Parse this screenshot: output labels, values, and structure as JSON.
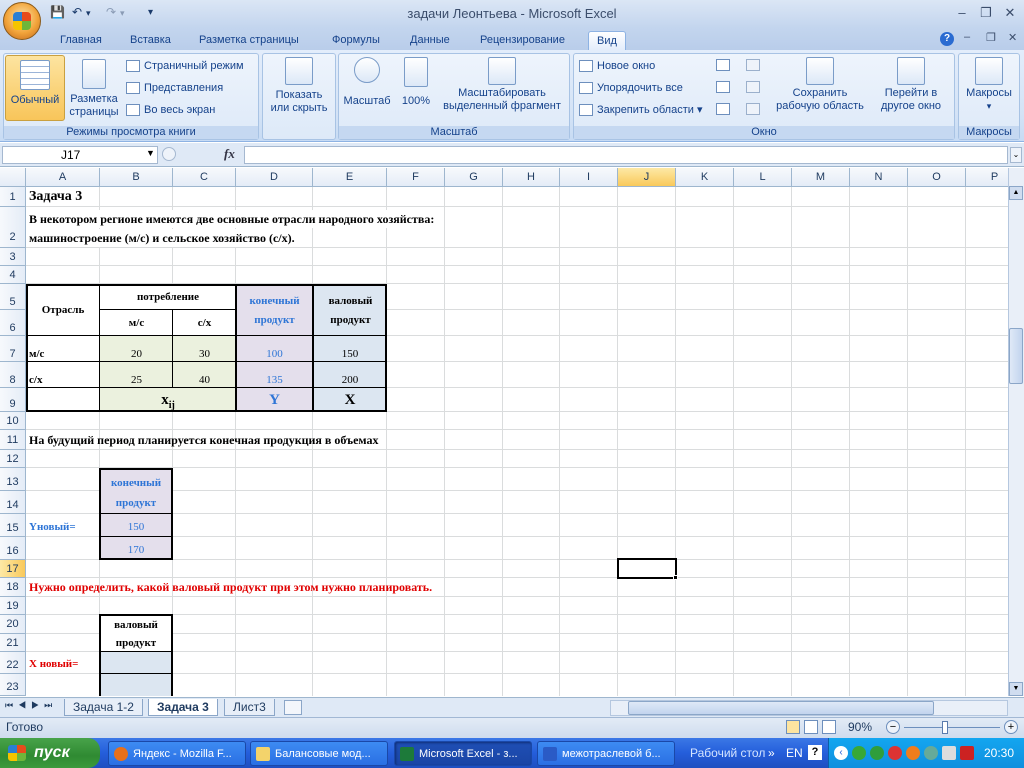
{
  "window": {
    "title": "задачи Леонтьева - Microsoft Excel",
    "min_symbol": "–",
    "max_symbol": "❐",
    "close_symbol": "✕",
    "ribbon_help_symbol": "?"
  },
  "ribbon": {
    "tabs": [
      "Главная",
      "Вставка",
      "Разметка страницы",
      "Формулы",
      "Данные",
      "Рецензирование",
      "Вид"
    ],
    "active_tab": "Вид",
    "groups": {
      "views": {
        "label": "Режимы просмотра книги",
        "normal": "Обычный",
        "page_layout_1": "Разметка",
        "page_layout_2": "страницы",
        "page_mode": "Страничный режим",
        "custom_views": "Представления",
        "full_screen": "Во весь экран"
      },
      "show_hide": {
        "label_1": "Показать",
        "label_2": "или скрыть"
      },
      "zoom": {
        "label": "Масштаб",
        "zoom": "Масштаб",
        "hundred": "100%",
        "selection_1": "Масштабировать",
        "selection_2": "выделенный фрагмент"
      },
      "window": {
        "label": "Окно",
        "new_window": "Новое окно",
        "arrange_all": "Упорядочить все",
        "freeze_panes": "Закрепить области",
        "save_ws_1": "Сохранить",
        "save_ws_2": "рабочую область",
        "switch_1": "Перейти в",
        "switch_2": "другое окно"
      },
      "macros": {
        "label": "Макросы",
        "button": "Макросы"
      }
    }
  },
  "formula_bar": {
    "name_box": "J17",
    "fx": "fx",
    "formula": ""
  },
  "grid": {
    "columns": [
      "A",
      "B",
      "C",
      "D",
      "E",
      "F",
      "G",
      "H",
      "I",
      "J",
      "K",
      "L",
      "M",
      "N",
      "O",
      "P"
    ],
    "rows": [
      "1",
      "2",
      "3",
      "4",
      "5",
      "6",
      "7",
      "8",
      "9",
      "10",
      "11",
      "12",
      "13",
      "14",
      "15",
      "16",
      "17",
      "18",
      "19",
      "20",
      "21",
      "22",
      "23"
    ],
    "selected_column": "J",
    "selected_row": "17",
    "cells": {
      "title": "Задача 3",
      "intro_1": "В некотором регионе имеются две основные отрасли народного хозяйства:",
      "intro_2": "машиностроение (м/с) и сельское хозяйство (с/х).",
      "table1": {
        "branch_header": "Отрасль",
        "consumption_header": "потребление",
        "col_ms": "м/с",
        "col_sh": "с/х",
        "final_header_1": "конечный",
        "final_header_2": "продукт",
        "gross_header_1": "валовый",
        "gross_header_2": "продукт",
        "row1_label": "м/с",
        "row1": [
          "20",
          "30",
          "100",
          "150"
        ],
        "row2_label": "с/х",
        "row2": [
          "25",
          "40",
          "135",
          "200"
        ],
        "xij_main": "x",
        "xij_sub": "ij",
        "y_symbol": "Y",
        "x_symbol": "X"
      },
      "future_text": "На будущий период планируется конечная продукция в объемах",
      "table2": {
        "header_1": "конечный",
        "header_2": "продукт",
        "label": "Yновый=",
        "values": [
          "150",
          "170"
        ]
      },
      "question": "Нужно определить, какой валовый продукт  при этом нужно планировать.",
      "table3": {
        "header_1": "валовый",
        "header_2": "продукт",
        "label": "X новый="
      }
    }
  },
  "sheets": {
    "tabs": [
      "Задача 1-2",
      "Задача 3",
      "Лист3"
    ],
    "active": "Задача 3"
  },
  "status": {
    "ready": "Готово",
    "zoom": "90%"
  },
  "taskbar": {
    "start": "пуск",
    "tasks": [
      "Яндекс - Mozilla F...",
      "Балансовые мод...",
      "Microsoft Excel - з...",
      "межотраслевой б..."
    ],
    "active_task": "Microsoft Excel - з...",
    "desktop": "Рабочий стол",
    "lang": "EN",
    "time": "20:30"
  }
}
